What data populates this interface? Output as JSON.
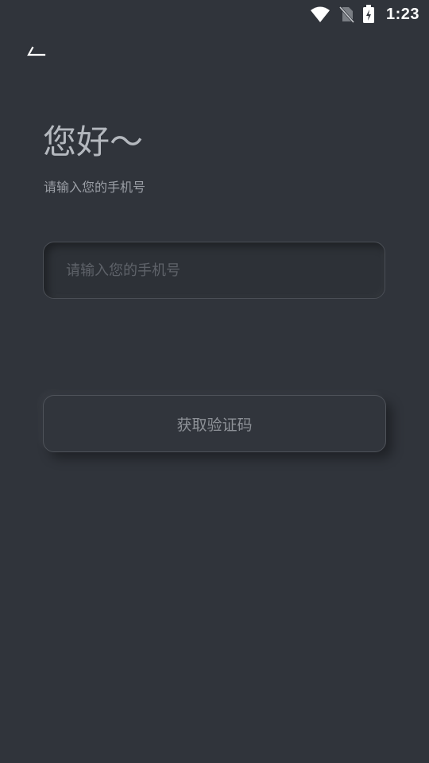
{
  "status_bar": {
    "time": "1:23",
    "icons": [
      "wifi-icon",
      "no-sim-icon",
      "battery-charging-icon"
    ]
  },
  "header": {
    "back_icon": "back-arrow-icon"
  },
  "greeting": {
    "title": "您好～",
    "subtitle": "请输入您的手机号"
  },
  "phone_input": {
    "value": "",
    "placeholder": "请输入您的手机号"
  },
  "get_code_button": {
    "label": "获取验证码"
  },
  "colors": {
    "background": "#30343b",
    "title_text": "#b4b8be",
    "button_text": "#8d9197",
    "placeholder_text": "#5e6269"
  }
}
